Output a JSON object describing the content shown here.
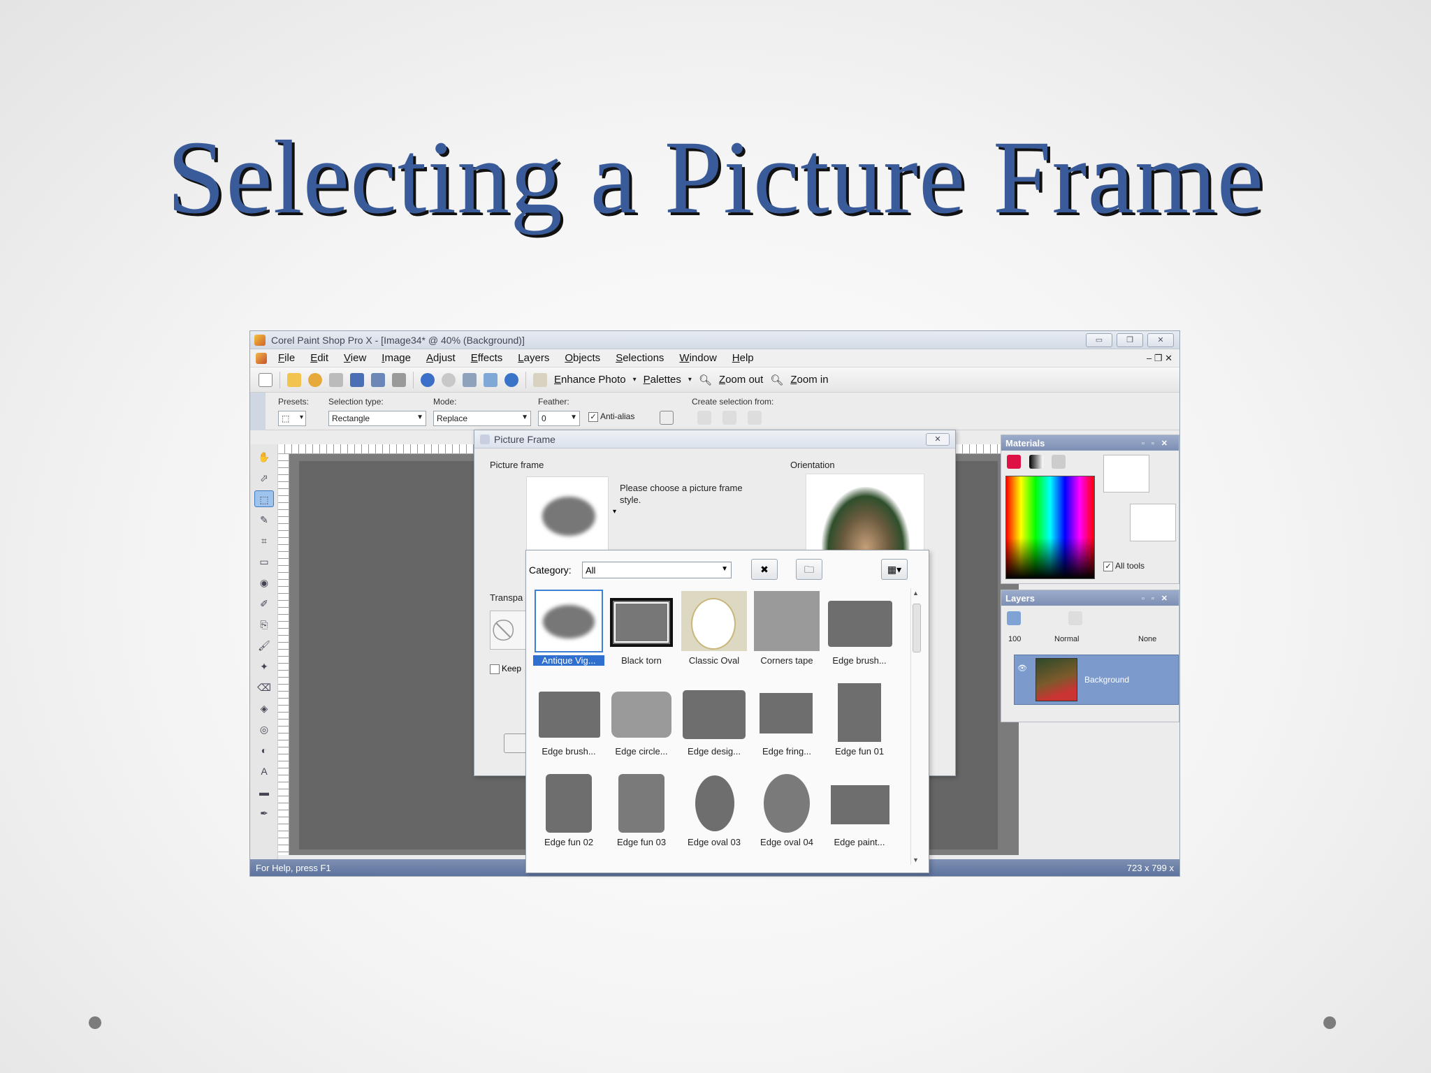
{
  "slide": {
    "title": "Selecting a Picture Frame"
  },
  "app": {
    "title": "Corel Paint Shop Pro X - [Image34* @  40% (Background)]",
    "menu": [
      "File",
      "Edit",
      "View",
      "Image",
      "Adjust",
      "Effects",
      "Layers",
      "Objects",
      "Selections",
      "Window",
      "Help"
    ],
    "toolbar": {
      "enhance_photo": "Enhance Photo",
      "palettes": "Palettes",
      "zoom_out": "Zoom out",
      "zoom_in": "Zoom in"
    },
    "options": {
      "presets_label": "Presets:",
      "selection_type_label": "Selection type:",
      "selection_type_value": "Rectangle",
      "mode_label": "Mode:",
      "mode_value": "Replace",
      "feather_label": "Feather:",
      "feather_value": "0",
      "anti_alias_label": "Anti-alias",
      "create_from_label": "Create selection from:"
    },
    "materials": {
      "title": "Materials",
      "all_tools_label": "All tools"
    },
    "layers": {
      "title": "Layers",
      "opacity": "100",
      "blend_mode": "Normal",
      "mask": "None",
      "layer_name": "Background"
    },
    "status": {
      "help": "For Help, press F1",
      "size": "723 x 799 x"
    }
  },
  "dialog": {
    "title": "Picture Frame",
    "picture_frame_label": "Picture frame",
    "prompt": "Please choose a picture frame style.",
    "orientation_label": "Orientation",
    "transparency_label": "Transpa",
    "keep_label": "Keep"
  },
  "gallery": {
    "category_label": "Category:",
    "category_value": "All",
    "items": [
      "Antique Vig...",
      "Black torn",
      "Classic Oval",
      "Corners tape",
      "Edge brush...",
      "Edge brush...",
      "Edge circle...",
      "Edge desig...",
      "Edge fring...",
      "Edge fun 01",
      "Edge fun 02",
      "Edge fun 03",
      "Edge oval 03",
      "Edge oval 04",
      "Edge paint..."
    ]
  }
}
